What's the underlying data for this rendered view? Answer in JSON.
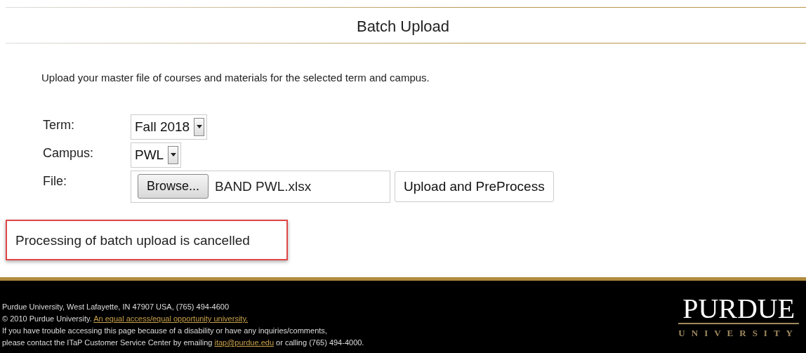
{
  "page_title": "Batch Upload",
  "intro": "Upload your master file of courses and materials for the selected term and campus.",
  "form": {
    "term": {
      "label": "Term:",
      "value": "Fall 2018"
    },
    "campus": {
      "label": "Campus:",
      "value": "PWL"
    },
    "file": {
      "label": "File:",
      "browse": "Browse...",
      "filename": "BAND PWL.xlsx"
    },
    "submit": "Upload and PreProcess"
  },
  "message": "Processing of batch upload is cancelled",
  "footer": {
    "lines": [
      {
        "text": "Purdue University, West Lafayette, IN 47907 USA, (765) 494-4600"
      },
      {
        "text": "© 2010 Purdue University. ",
        "link": "An equal access/equal opportunity university."
      },
      {
        "text": "If you have trouble accessing this page because of a disability or have any inquiries/comments,"
      },
      {
        "text": "please contact the ITaP Customer Service Center by emailing ",
        "link": "itap@purdue.edu",
        "after": " or calling (765) 494-4000."
      }
    ],
    "logo": {
      "name": "PURDUE",
      "sub": "UNIVERSITY"
    }
  }
}
